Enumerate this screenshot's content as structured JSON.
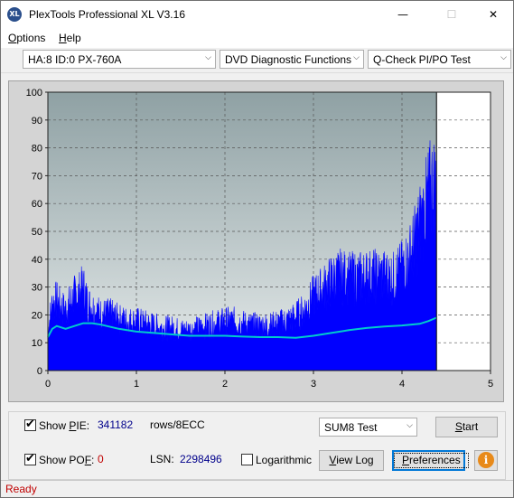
{
  "window": {
    "title": "PlexTools Professional XL V3.16",
    "icon_label": "XL",
    "minimize_glyph": "—",
    "maximize_glyph": "☐",
    "close_glyph": "✕"
  },
  "menu": {
    "options": {
      "pre": "",
      "key": "O",
      "rest": "ptions"
    },
    "help": {
      "pre": "",
      "key": "H",
      "rest": "elp"
    }
  },
  "toolbar": {
    "drive": "HA:8 ID:0  PX-760A",
    "function": "DVD Diagnostic Functions",
    "test": "Q-Check PI/PO Test"
  },
  "chart_data": {
    "type": "bar",
    "xlim": [
      0,
      5
    ],
    "ylim": [
      0,
      100
    ],
    "x_ticks": [
      "0",
      "1",
      "2",
      "3",
      "4",
      "5"
    ],
    "y_ticks": [
      "0",
      "10",
      "20",
      "30",
      "40",
      "50",
      "60",
      "70",
      "80",
      "90",
      "100"
    ],
    "grid": true,
    "scan_end_x": 4.39,
    "series": [
      {
        "kind": "bars",
        "color": "#0000ff",
        "x": [
          0.0,
          0.05,
          0.1,
          0.15,
          0.2,
          0.25,
          0.3,
          0.35,
          0.4,
          0.45,
          0.5,
          0.6,
          0.7,
          0.8,
          0.9,
          1.0,
          1.1,
          1.2,
          1.3,
          1.4,
          1.5,
          1.6,
          1.7,
          1.8,
          1.9,
          2.0,
          2.1,
          2.2,
          2.3,
          2.4,
          2.5,
          2.6,
          2.7,
          2.8,
          2.9,
          3.0,
          3.1,
          3.2,
          3.3,
          3.4,
          3.5,
          3.6,
          3.7,
          3.8,
          3.9,
          4.0,
          4.05,
          4.1,
          4.15,
          4.2,
          4.25,
          4.3,
          4.35,
          4.39
        ],
        "y": [
          18,
          30,
          31,
          28,
          27,
          30,
          33,
          34,
          37,
          30,
          28,
          25,
          25,
          23,
          22,
          22,
          21,
          20,
          19,
          19,
          18,
          18,
          19,
          20,
          21,
          22,
          22,
          21,
          20,
          20,
          20,
          21,
          22,
          24,
          27,
          33,
          36,
          40,
          42,
          41,
          41,
          42,
          42,
          42,
          41,
          45,
          48,
          52,
          58,
          65,
          70,
          78,
          83,
          80
        ]
      },
      {
        "kind": "line",
        "color": "#00cccc",
        "x": [
          0.0,
          0.05,
          0.1,
          0.2,
          0.3,
          0.4,
          0.5,
          0.6,
          0.8,
          1.0,
          1.2,
          1.4,
          1.6,
          1.8,
          2.0,
          2.2,
          2.4,
          2.6,
          2.8,
          3.0,
          3.2,
          3.4,
          3.6,
          3.8,
          4.0,
          4.2,
          4.3,
          4.39
        ],
        "y": [
          12,
          15,
          16,
          15,
          16,
          17,
          17,
          16.5,
          15,
          14,
          13.5,
          13,
          12.5,
          12.5,
          12.5,
          12.2,
          12,
          12,
          11.8,
          12.5,
          13.5,
          14.5,
          15.3,
          15.8,
          16.2,
          16.8,
          17.8,
          19
        ]
      }
    ]
  },
  "controls": {
    "show_pie_label": {
      "pre": "Show ",
      "key": "P",
      "rest": "IE:"
    },
    "show_pie_checked": "✔",
    "pie_value": "341182",
    "pie_unit": "rows/8ECC",
    "show_pof_label": {
      "pre": "Show PO",
      "key": "F",
      "rest": ":"
    },
    "show_pof_checked": "✔",
    "pof_value": "0",
    "lsn_label": "LSN:",
    "lsn_value": "2298496",
    "logarithmic_label": "Logarithmic",
    "sum_test": "SUM8 Test",
    "start_button": {
      "pre": "",
      "key": "S",
      "rest": "tart"
    },
    "view_log_button": {
      "pre": "",
      "key": "V",
      "rest": "iew Log"
    },
    "preferences_button": {
      "pre": "",
      "key": "P",
      "rest": "references"
    },
    "info_glyph": "i"
  },
  "status": {
    "text": "Ready"
  }
}
